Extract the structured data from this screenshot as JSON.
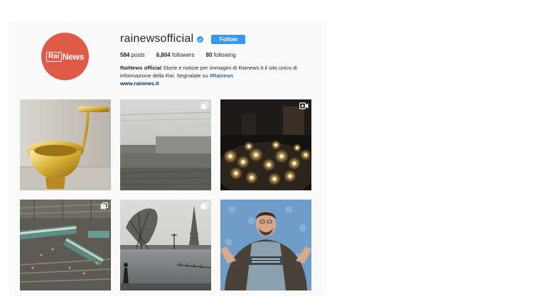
{
  "profile": {
    "username": "rainewsofficial",
    "follow_label": "Follow",
    "avatar_logo_rai": "Rai",
    "avatar_logo_news": "News",
    "stats": {
      "posts_count": "584",
      "posts_label": "posts",
      "followers_count": "6,804",
      "followers_label": "followers",
      "following_count": "80",
      "following_label": "following"
    },
    "bio": {
      "name": "RaiNews official",
      "text": "Storie e notizie per immagini di Rainews.it il sito unico di informazione della Rai. Segnalate su",
      "hashtag": "#Rainews",
      "website": "www.rainews.it"
    }
  },
  "posts": [
    {
      "subject": "golden toilet",
      "overlay_icon": null
    },
    {
      "subject": "grey rainy landscape from a train",
      "overlay_icon": "multiple-images-icon"
    },
    {
      "subject": "candlelight vigil at night",
      "overlay_icon": "video-camera-icon"
    },
    {
      "subject": "train derailment aerial view",
      "overlay_icon": "multiple-images-icon"
    },
    {
      "subject": "flooded Seine with Eiffel Tower",
      "overlay_icon": "multiple-images-icon"
    },
    {
      "subject": "man in printed sweater at Berlinale",
      "overlay_icon": null
    }
  ],
  "colors": {
    "avatar_bg": "#e05a48",
    "follow_button": "#3897f0",
    "verified_badge": "#3897f0",
    "link": "#003569",
    "text": "#262626",
    "panel_bg": "#fafafa"
  }
}
